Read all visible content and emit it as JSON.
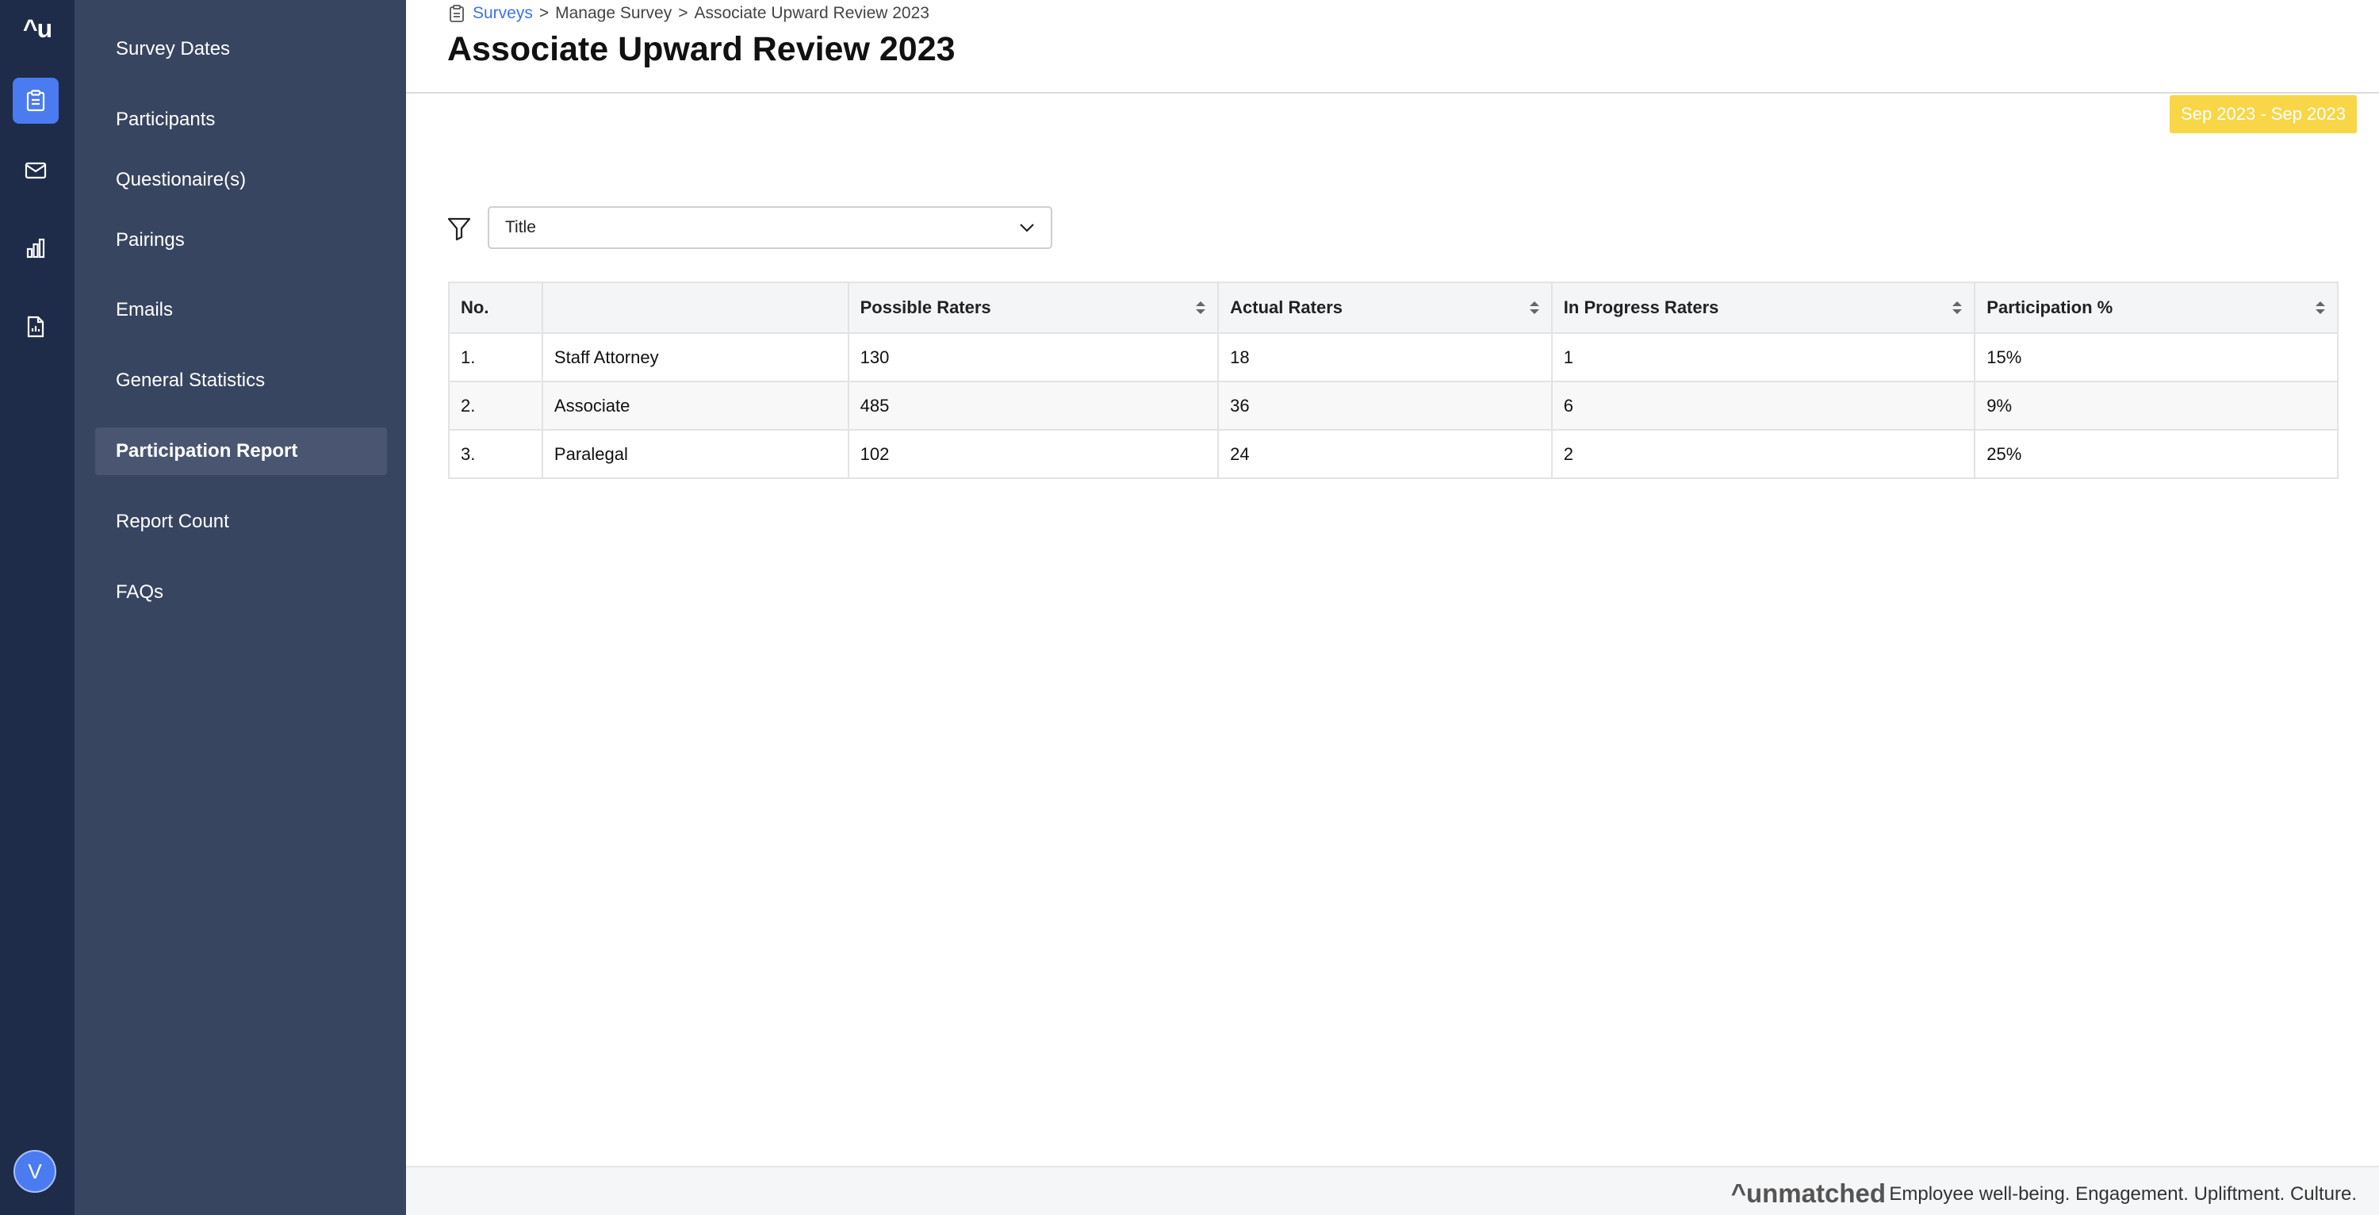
{
  "app": {
    "logo": "^u",
    "avatar_initial": "V",
    "rail_icons": [
      "clipboard-icon",
      "mail-icon",
      "bar-chart-icon",
      "report-icon"
    ]
  },
  "menu": {
    "items": [
      {
        "label": "Survey Dates"
      },
      {
        "label": "Participants"
      },
      {
        "label": "Questionaire(s)"
      },
      {
        "label": "Pairings"
      },
      {
        "label": "Emails"
      },
      {
        "label": "General Statistics"
      },
      {
        "label": "Participation Report"
      },
      {
        "label": "Report Count"
      },
      {
        "label": "FAQs"
      }
    ],
    "active_index": 6
  },
  "breadcrumb": {
    "link": "Surveys",
    "separator": ">",
    "middle": "Manage Survey",
    "current": "Associate Upward Review 2023"
  },
  "page": {
    "title": "Associate Upward Review 2023",
    "date_range": "Sep 2023 - Sep 2023"
  },
  "filter": {
    "selected": "Title"
  },
  "table": {
    "headers": [
      "No.",
      "",
      "Possible Raters",
      "Actual Raters",
      "In Progress Raters",
      "Participation %"
    ],
    "rows": [
      [
        "1.",
        "Staff Attorney",
        "130",
        "18",
        "1",
        "15%"
      ],
      [
        "2.",
        "Associate",
        "485",
        "36",
        "6",
        "9%"
      ],
      [
        "3.",
        "Paralegal",
        "102",
        "24",
        "2",
        "25%"
      ]
    ]
  },
  "footer": {
    "brand": "^unmatched",
    "tagline": "Employee well-being. Engagement. Upliftment. Culture."
  },
  "colors": {
    "rail": "#1e2c49",
    "menu": "#384560",
    "accent": "#4a7bf0",
    "badge": "#f9d648",
    "link": "#3c73e3"
  }
}
